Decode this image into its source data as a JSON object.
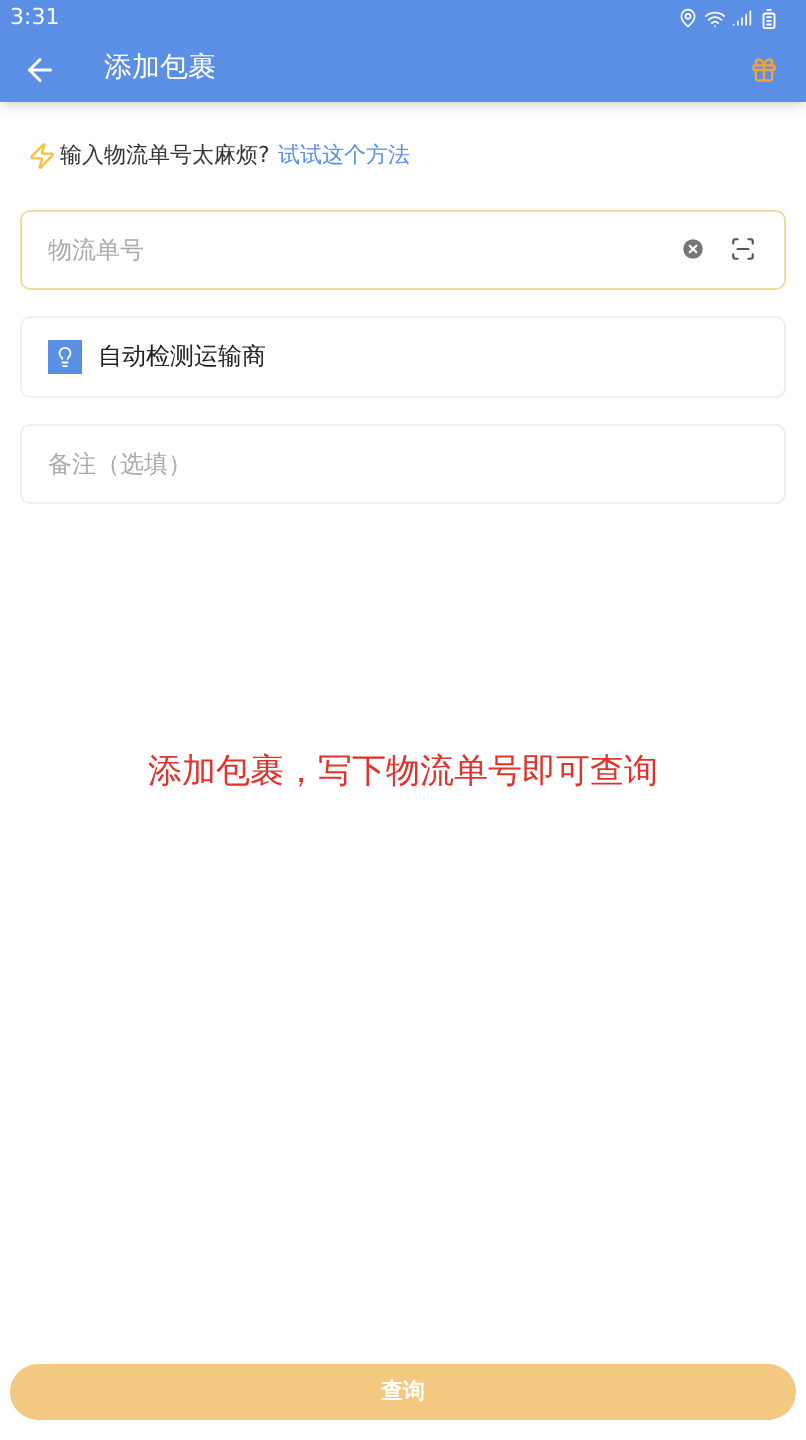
{
  "status_bar": {
    "time": "3:31"
  },
  "app_bar": {
    "title": "添加包裹"
  },
  "hint": {
    "text": "输入物流单号太麻烦?",
    "link": "试试这个方法"
  },
  "tracking_field": {
    "placeholder": "物流单号"
  },
  "carrier": {
    "label": "自动检测运输商"
  },
  "note_field": {
    "placeholder": "备注（选填）"
  },
  "caption": "添加包裹，写下物流单号即可查询",
  "submit": {
    "label": "查询",
    "disabled": true
  }
}
